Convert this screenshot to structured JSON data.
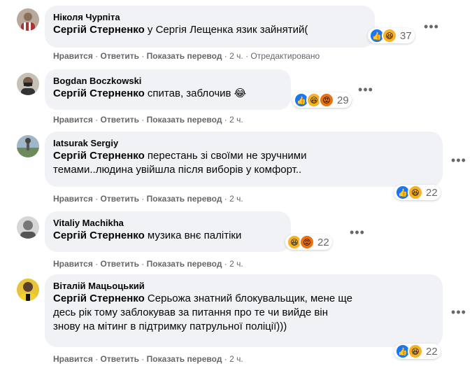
{
  "labels": {
    "like": "Нравится",
    "reply": "Ответить",
    "translate": "Показать перевод",
    "sep": "·",
    "edited": "Отредактировано"
  },
  "comments": [
    {
      "author": "Ніколя Чурпіта",
      "mention": "Сергій Стерненко",
      "lines": [
        " у Сергія Лещенка язик зайнятий("
      ],
      "reaction_count": "37",
      "time": "2 ч."
    },
    {
      "author": "Bogdan Boczkowski",
      "mention": "Сергій Стерненко",
      "lines": [
        " спитав, заблочив 😂"
      ],
      "reaction_count": "29",
      "time": "2 ч."
    },
    {
      "author": "Iatsurak Sergiy",
      "mention": "Сергій Стерненко",
      "lines": [
        " перестань зі своїми не зручними",
        "темами..людина увійшла після виборів у комфорт.."
      ],
      "reaction_count": "22",
      "time": "2 ч."
    },
    {
      "author": "Vitaliy Machikha",
      "mention": "Сергій Стерненко",
      "lines": [
        " музика внє палітіки"
      ],
      "reaction_count": "22",
      "time": "2 ч."
    },
    {
      "author": "Віталій Мацьоцький",
      "mention": "Сергій Стерненко",
      "lines": [
        " Серьожа знатний блокувальщик, мене ще",
        "десь рік тому заблокував за питання про те чи вийде він",
        "знову на мітинг в підтримку патрульної поліції)))"
      ],
      "reaction_count": "22",
      "time": "2 ч."
    }
  ],
  "colors": {
    "bubble": "#f0f2f5",
    "meta": "#65676b",
    "like": "#1877f2",
    "haha": "#f7b125",
    "angry": "#e9710f"
  }
}
